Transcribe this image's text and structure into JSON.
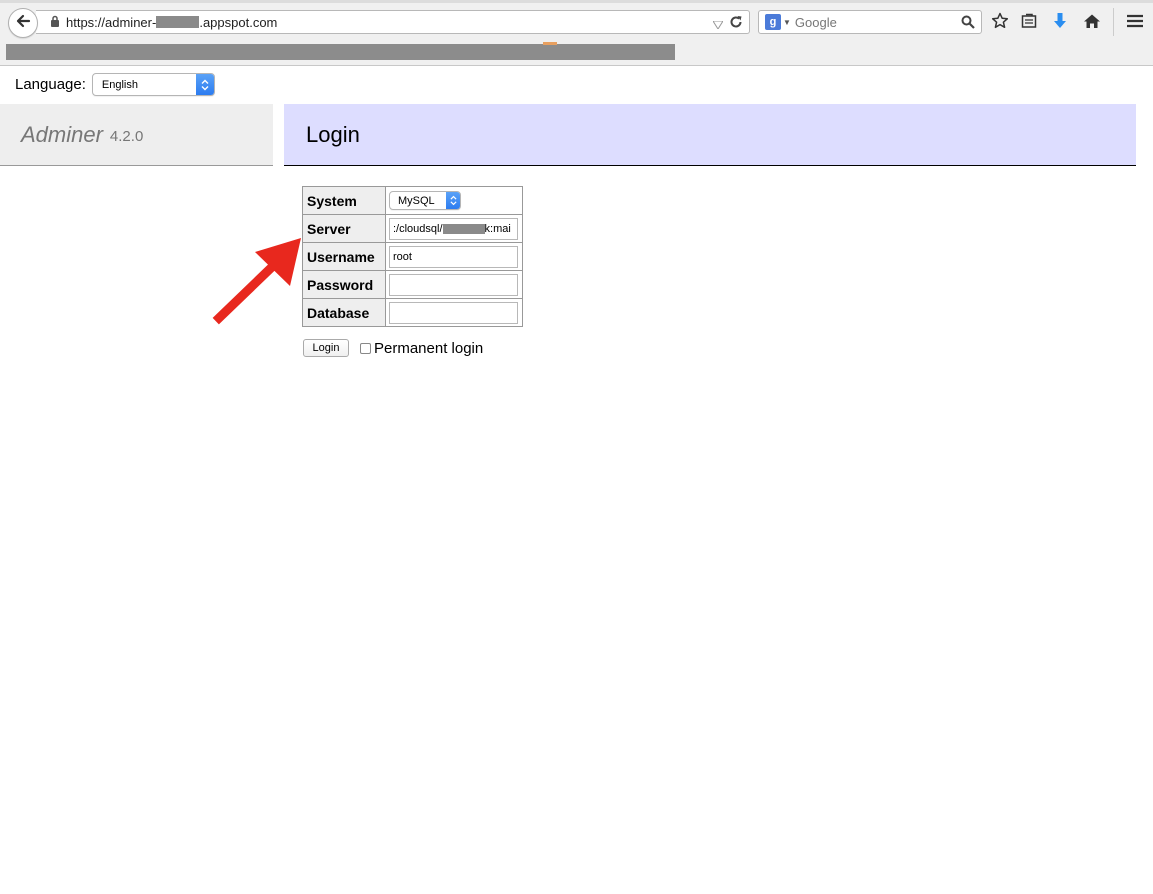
{
  "browser": {
    "url_prefix": "https://adminer-",
    "url_suffix": ".appspot.com",
    "search_placeholder": "Google",
    "search_engine_icon": "g"
  },
  "language": {
    "label": "Language:",
    "selected": "English"
  },
  "brand": {
    "name": "Adminer",
    "version": "4.2.0"
  },
  "page_title": "Login",
  "form": {
    "system_label": "System",
    "system_value": "MySQL",
    "server_label": "Server",
    "server_value_prefix": ":/cloudsql/",
    "server_value_suffix": "k:mai",
    "username_label": "Username",
    "username_value": "root",
    "password_label": "Password",
    "password_value": "",
    "database_label": "Database",
    "database_value": "",
    "login_button": "Login",
    "permanent_login": "Permanent login"
  },
  "annotation_color": "#e8281e"
}
